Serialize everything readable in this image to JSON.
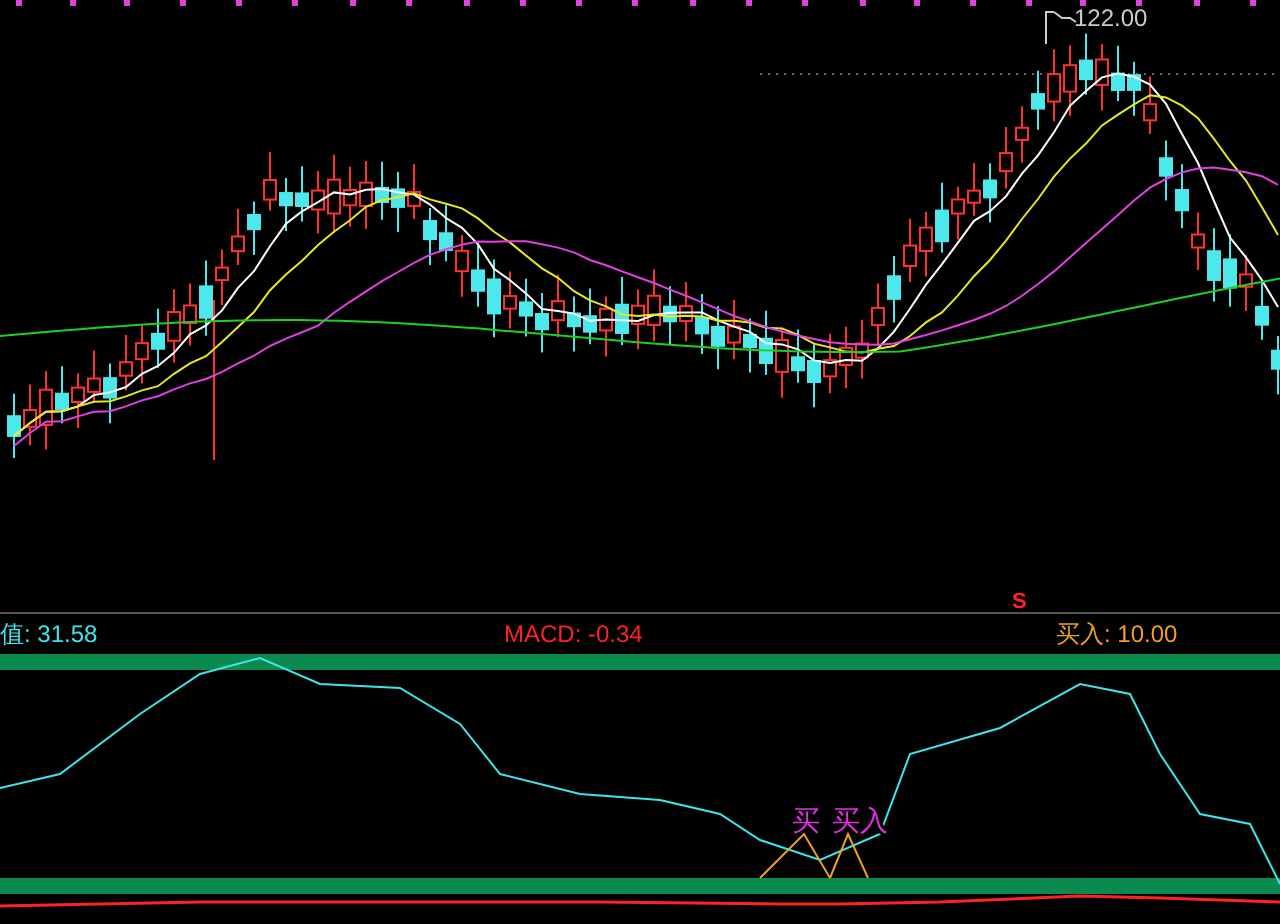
{
  "price_chart": {
    "high_label": "122.00",
    "signal_marker": "S"
  },
  "indicator_bar": {
    "value_label": "值: 31.58",
    "macd_label": "MACD: -0.34",
    "buy_label": "买入: 10.00"
  },
  "buy_markers": [
    {
      "text": "买"
    },
    {
      "text": "买入"
    }
  ]
}
